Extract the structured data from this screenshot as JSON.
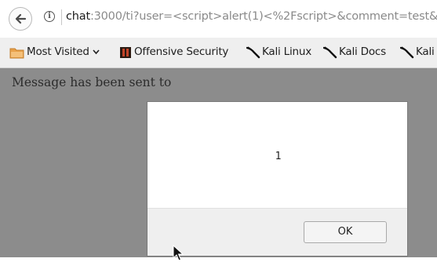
{
  "browser": {
    "url_host": "chat",
    "url_rest": ":3000/ti?user=<script>alert(1)<%2Fscript>&comment=test&",
    "info_icon": "info-icon",
    "back_icon": "back-arrow-icon"
  },
  "bookmarks": [
    {
      "label": "Most Visited",
      "icon": "folder-icon"
    },
    {
      "label": "Offensive Security",
      "icon": "offsec-icon"
    },
    {
      "label": "Kali Linux",
      "icon": "kali-dragon-icon"
    },
    {
      "label": "Kali Docs",
      "icon": "kali-dragon-icon"
    },
    {
      "label": "Kali",
      "icon": "kali-dragon-icon"
    }
  ],
  "page": {
    "message": "Message has been sent to"
  },
  "dialog": {
    "message": "1",
    "ok_label": "OK"
  },
  "colors": {
    "page_overlay": "#8c8c8c",
    "dialog_footer": "#efefef"
  }
}
